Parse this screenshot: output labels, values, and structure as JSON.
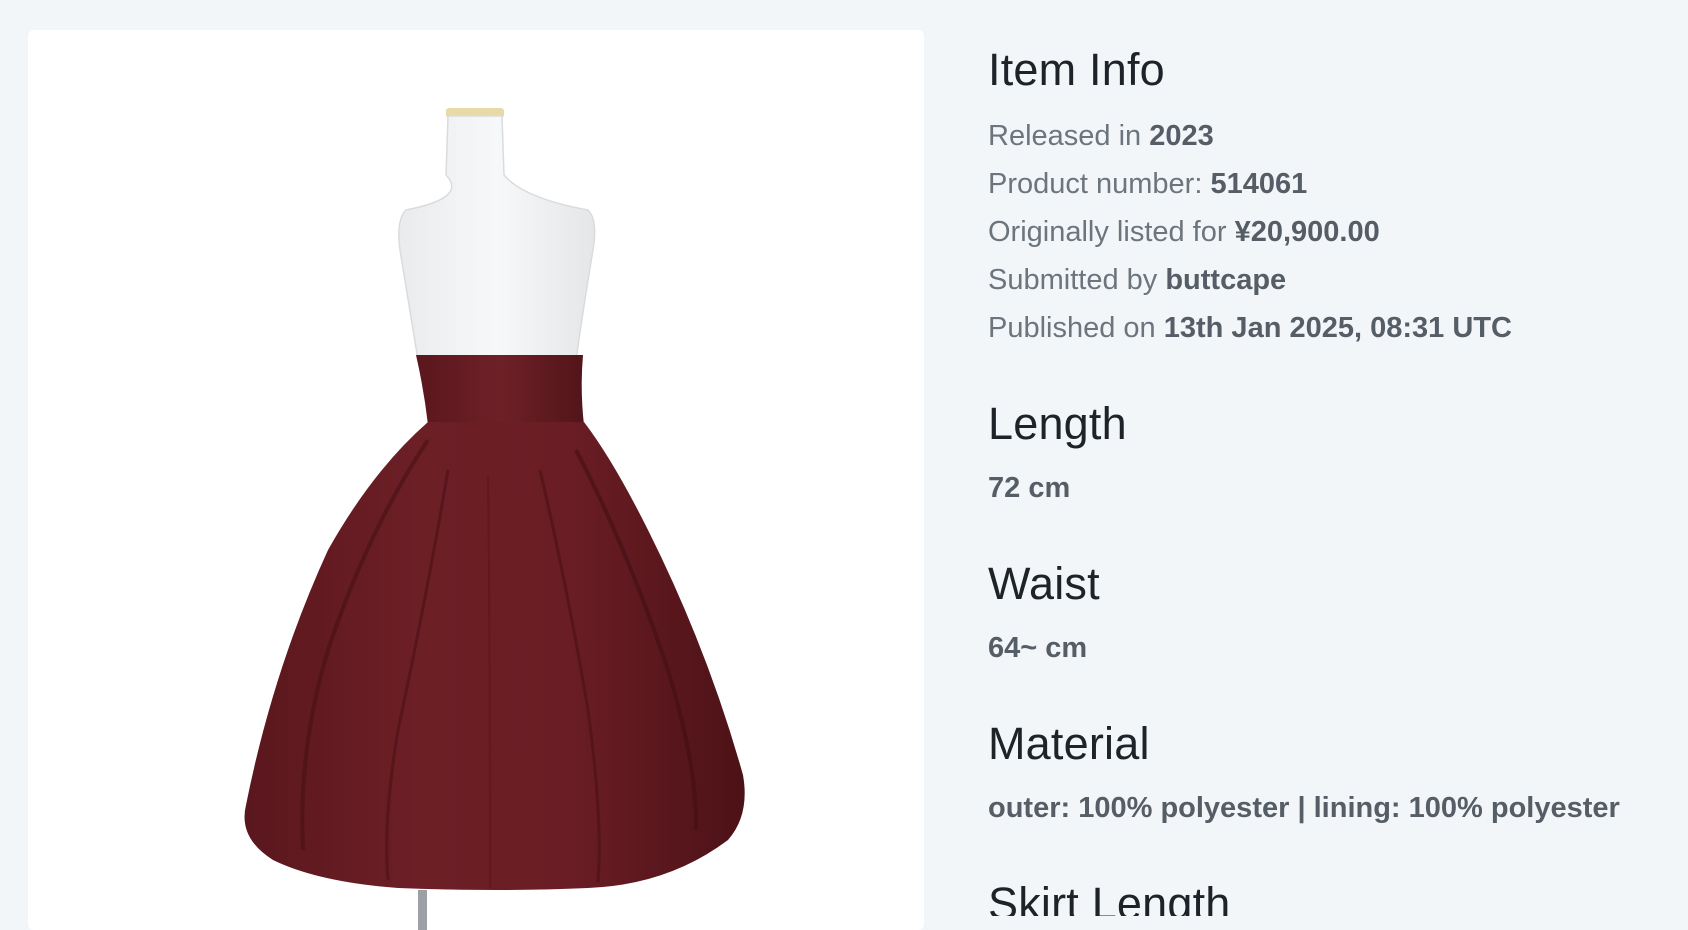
{
  "image": {
    "alt": "burgundy high-waist flared skirt on white dress form",
    "colors": {
      "skirt": "#6b1e24",
      "skirt_shadow": "#4f1419",
      "mannequin": "#f3f4f5",
      "stand": "#9aa0a6"
    }
  },
  "item_info": {
    "heading": "Item Info",
    "released_prefix": "Released in",
    "released_value": "2023",
    "product_number_prefix": "Product number:",
    "product_number_value": "514061",
    "price_prefix": "Originally listed for",
    "price_value": "¥20,900.00",
    "submitted_prefix": "Submitted by",
    "submitted_value": "buttcape",
    "published_prefix": "Published on",
    "published_value": "13th Jan 2025, 08:31 UTC"
  },
  "length": {
    "heading": "Length",
    "value": "72 cm"
  },
  "waist": {
    "heading": "Waist",
    "value": "64~ cm"
  },
  "material": {
    "heading": "Material",
    "value": "outer: 100% polyester | lining: 100% polyester"
  },
  "skirt_length": {
    "heading": "Skirt Length"
  }
}
